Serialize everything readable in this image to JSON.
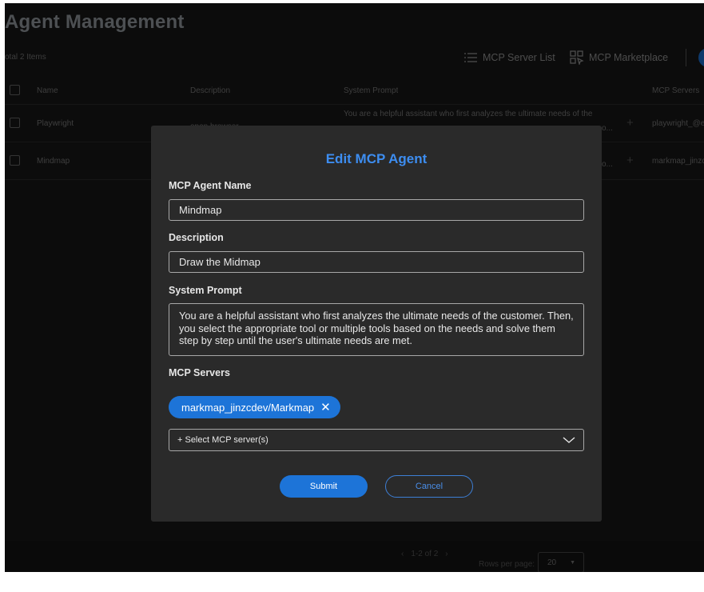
{
  "page": {
    "title": "Agent Management",
    "total_items": "otal 2 Items"
  },
  "toolbar": {
    "server_list_label": "MCP Server List",
    "marketplace_label": "MCP Marketplace"
  },
  "table": {
    "columns": [
      "Name",
      "Description",
      "System Prompt",
      "MCP Servers"
    ],
    "rows": [
      {
        "name": "Playwright",
        "description": "open browser",
        "prompt_line1": "You are a helpful assistant who first analyzes the ultimate needs of the",
        "prompt_tail": "o...",
        "servers": "playwright_@e"
      },
      {
        "name": "Mindmap",
        "description": "",
        "prompt_line1": "",
        "prompt_tail": "o...",
        "servers": "markmap_jinzc"
      }
    ]
  },
  "footer": {
    "range": "1-2 of 2",
    "rows_per_page_label": "Rows per page:",
    "rows_per_page_value": "20"
  },
  "modal": {
    "title": "Edit MCP Agent",
    "name_label": "MCP Agent Name",
    "name_value": "Mindmap",
    "description_label": "Description",
    "description_value": "Draw the Midmap",
    "prompt_label": "System Prompt",
    "prompt_value": "You are a helpful assistant who first analyzes the ultimate needs of the customer. Then, you select the appropriate tool or multiple tools based on the needs and solve them step by step until the user's ultimate needs are met.",
    "servers_label": "MCP Servers",
    "selected_server": "markmap_jinzcdev/Markmap",
    "select_placeholder": "+ Select MCP server(s)",
    "submit_label": "Submit",
    "cancel_label": "Cancel"
  },
  "colors": {
    "accent": "#1d74d8",
    "title_blue": "#3d8df0",
    "modal_bg": "#2a2a2a",
    "page_bg": "#181818"
  },
  "icons": [
    "list-icon",
    "marketplace-icon",
    "chevron-down-icon",
    "close-icon",
    "plus-icon",
    "chevron-left-icon",
    "chevron-right-icon"
  ]
}
